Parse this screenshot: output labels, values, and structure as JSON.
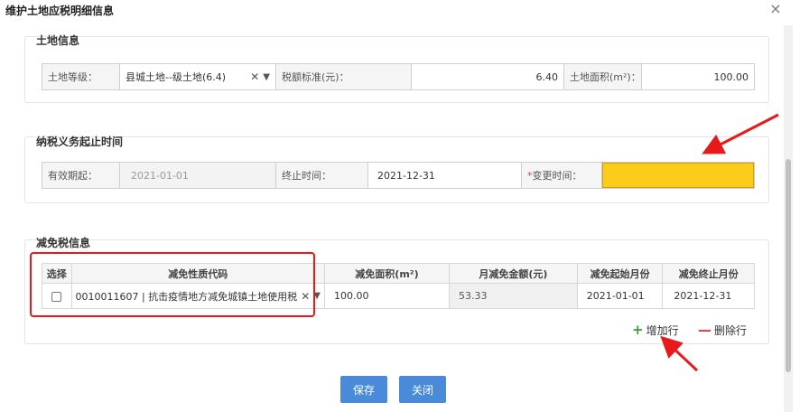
{
  "dialog": {
    "title": "维护土地应税明细信息",
    "close_icon": "close-icon"
  },
  "land_info": {
    "title": "土地信息",
    "grade_label": "土地等级：",
    "grade_value": "县城土地--级土地(6.4)",
    "standard_label": "税额标准(元)：",
    "standard_value": "6.40",
    "area_label": "土地面积(m²)：",
    "area_value": "100.00"
  },
  "tax_period": {
    "title": "纳税义务起止时间",
    "start_label": "有效期起：",
    "start_value": "2021-01-01",
    "end_label": "终止时间：",
    "end_value": "2021-12-31",
    "change_required_mark": "*",
    "change_label": "变更时间：",
    "change_value": ""
  },
  "relief": {
    "title": "减免税信息",
    "columns": [
      "选择",
      "减免性质代码",
      "减免面积(m²)",
      "月减免金额(元)",
      "减免起始月份",
      "减免终止月份"
    ],
    "rows": [
      {
        "code": "0010011607 | 抗击疫情地方减免城镇土地使用税",
        "area": "100.00",
        "monthly_amount": "53.33",
        "start_month": "2021-01-01",
        "end_month": "2021-12-31"
      }
    ],
    "add_row": "增加行",
    "delete_row": "删除行"
  },
  "buttons": {
    "save": "保存",
    "close": "关闭"
  },
  "colors": {
    "accent": "#4a8bd9",
    "highlight": "#fccc1d",
    "annotation": "#e8191a"
  }
}
